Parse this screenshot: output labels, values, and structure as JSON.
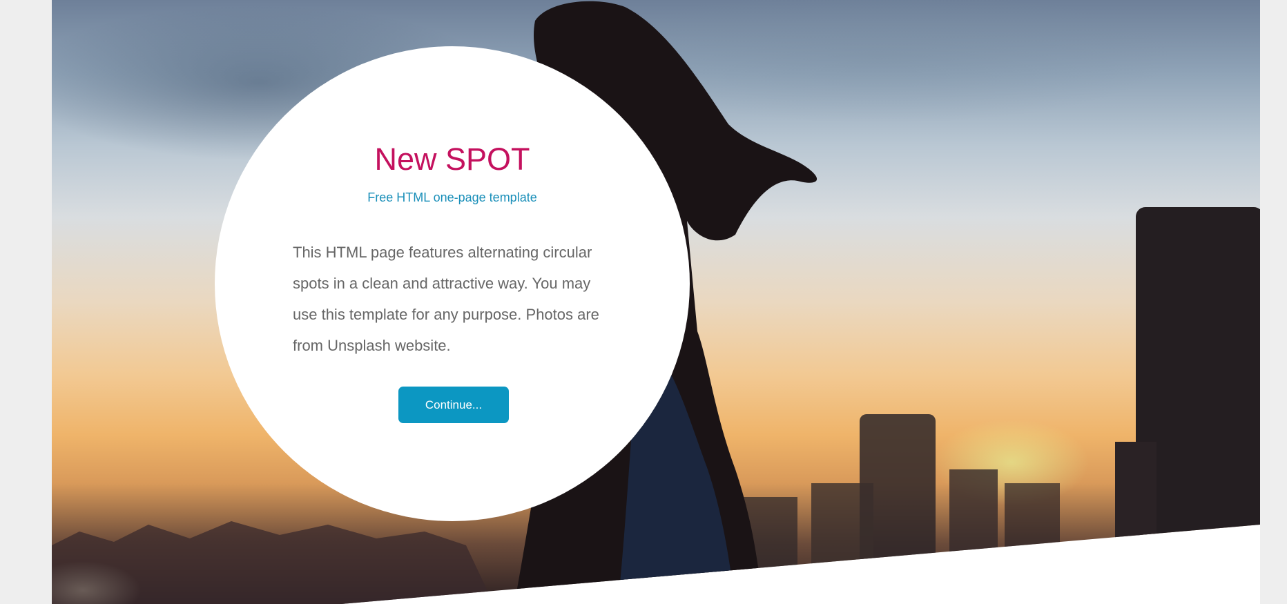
{
  "hero": {
    "title": "New SPOT",
    "subtitle": "Free HTML one-page template",
    "description": "This HTML page features alternating circular spots in a clean and attractive way. You may use this template for any purpose. Photos are from Unsplash website.",
    "button_label": "Continue..."
  },
  "colors": {
    "title": "#c4115e",
    "subtitle": "#1a8fb9",
    "button_bg": "#0c97c2",
    "body_text": "#666666",
    "page_bg": "#eeeeee"
  }
}
